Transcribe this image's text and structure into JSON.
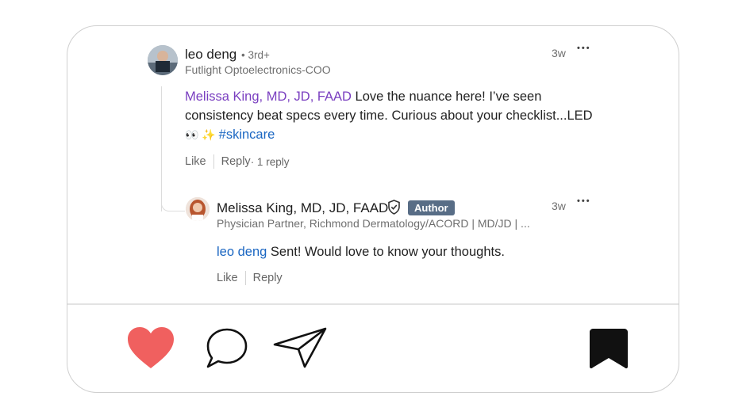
{
  "comment": {
    "author": "leo deng",
    "degree": "• 3rd+",
    "headline": "Futlight Optoelectronics-COO",
    "time": "3w",
    "more": "•••",
    "mention": "Melissa King, MD, JD, FAAD",
    "text_line1": " Love the nuance here! I’ve seen",
    "text_line2": "consistency beat specs every time. Curious about your checklist...LED",
    "emoji": "👀 ✨ ",
    "hashtag": "#skincare",
    "like_label": "Like",
    "reply_label": "Reply",
    "reply_count": " · 1 reply"
  },
  "reply": {
    "author": "Melissa King, MD, JD, FAAD",
    "badge": "Author",
    "headline": "Physician Partner, Richmond Dermatology/ACORD | MD/JD | ...",
    "time": "3w",
    "more": "•••",
    "mention": "leo deng",
    "text": " Sent! Would love to know your thoughts.",
    "like_label": "Like",
    "reply_label": "Reply"
  },
  "action_bar": {
    "icons": [
      "heart-icon",
      "comment-icon",
      "share-icon",
      "bookmark-icon"
    ],
    "heart_color": "#f0605f"
  }
}
